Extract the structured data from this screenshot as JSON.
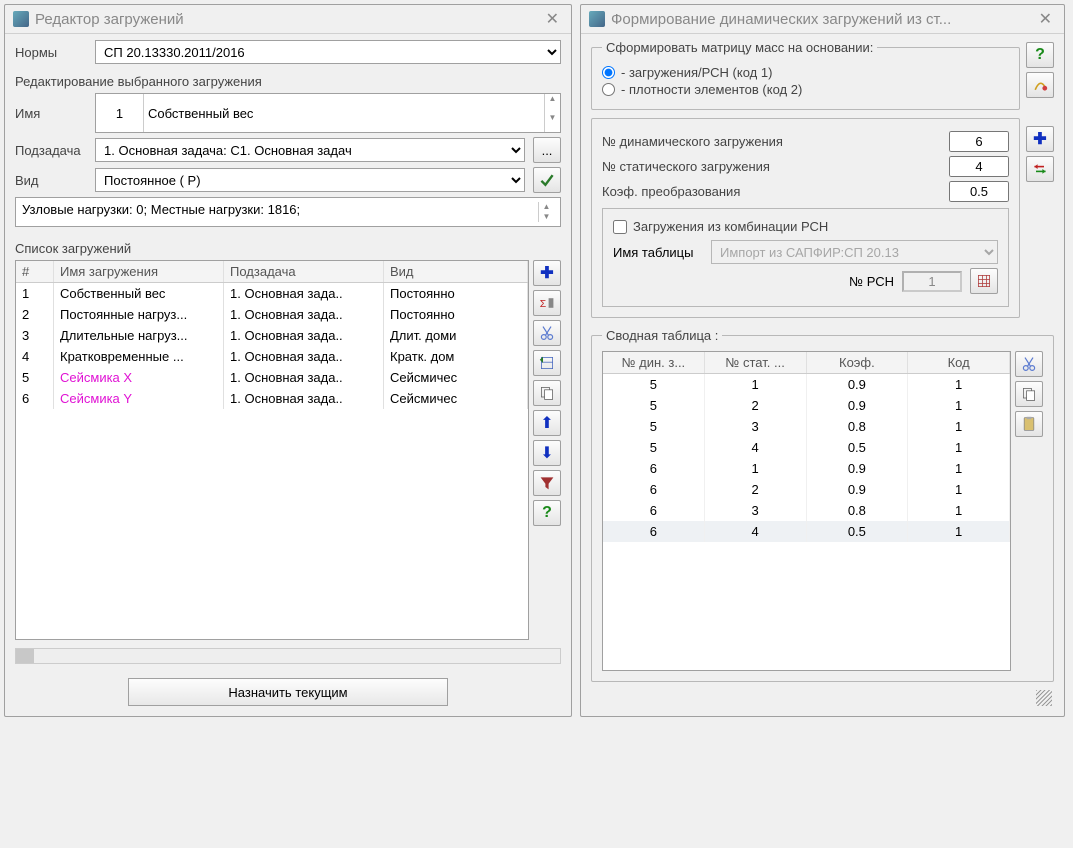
{
  "left": {
    "title": "Редактор загружений",
    "norms_label": "Нормы",
    "norms_value": "СП 20.13330.2011/2016",
    "edit_section": "Редактирование выбранного загружения",
    "name_label": "Имя",
    "name_index": "1",
    "name_value": "Собственный вес",
    "subtask_label": "Подзадача",
    "subtask_value": "1. Основная задача: С1. Основная задач",
    "kind_label": "Вид",
    "kind_value": "Постоянное ( Р)",
    "loads_summary": "Узловые нагрузки:  0;  Местные нагрузки:  1816;",
    "list_title": "Список загружений",
    "cols": {
      "n": "#",
      "name": "Имя загружения",
      "sub": "Подзадача",
      "kind": "Вид"
    },
    "rows": [
      {
        "n": "1",
        "name": "Собственный вес",
        "sub": "1. Основная зада..",
        "kind": "Постоянно",
        "pink": false
      },
      {
        "n": "2",
        "name": "Постоянные нагруз...",
        "sub": "1. Основная зада..",
        "kind": "Постоянно",
        "pink": false
      },
      {
        "n": "3",
        "name": "Длительные нагруз...",
        "sub": "1. Основная зада..",
        "kind": "Длит. доми",
        "pink": false
      },
      {
        "n": "4",
        "name": "Кратковременные ...",
        "sub": "1. Основная зада..",
        "kind": "Кратк. дом",
        "pink": false
      },
      {
        "n": "5",
        "name": "Сейсмика X",
        "sub": "1. Основная зада..",
        "kind": "Сейсмичес",
        "pink": true
      },
      {
        "n": "6",
        "name": "Сейсмика Y",
        "sub": "1. Основная зада..",
        "kind": "Сейсмичес",
        "pink": true
      }
    ],
    "assign_btn": "Назначить текущим"
  },
  "right": {
    "title": "Формирование динамических загружений из ст...",
    "matrix_legend": "Сформировать матрицу масс на основании:",
    "radio1": "- загружения/РСН (код 1)",
    "radio2": "- плотности элементов (код 2)",
    "dyn_label": "№ динамического загружения",
    "dyn_value": "6",
    "stat_label": "№ статического загружения",
    "stat_value": "4",
    "coef_label": "Коэф. преобразования",
    "coef_value": "0.5",
    "chk_label": "Загружения из комбинации РСН",
    "tbl_name_label": "Имя таблицы",
    "tbl_name_value": "Импорт из САПФИР:СП 20.13",
    "rsn_label": "№ РСН",
    "rsn_value": "1",
    "summary_legend": "Сводная таблица :",
    "scols": {
      "dyn": "№ дин. з...",
      "stat": "№ стат. ...",
      "coef": "Коэф.",
      "code": "Код"
    },
    "srows": [
      {
        "dyn": "5",
        "stat": "1",
        "coef": "0.9",
        "code": "1",
        "sel": false
      },
      {
        "dyn": "5",
        "stat": "2",
        "coef": "0.9",
        "code": "1",
        "sel": false
      },
      {
        "dyn": "5",
        "stat": "3",
        "coef": "0.8",
        "code": "1",
        "sel": false
      },
      {
        "dyn": "5",
        "stat": "4",
        "coef": "0.5",
        "code": "1",
        "sel": false
      },
      {
        "dyn": "6",
        "stat": "1",
        "coef": "0.9",
        "code": "1",
        "sel": false
      },
      {
        "dyn": "6",
        "stat": "2",
        "coef": "0.9",
        "code": "1",
        "sel": false
      },
      {
        "dyn": "6",
        "stat": "3",
        "coef": "0.8",
        "code": "1",
        "sel": false
      },
      {
        "dyn": "6",
        "stat": "4",
        "coef": "0.5",
        "code": "1",
        "sel": true
      }
    ]
  }
}
